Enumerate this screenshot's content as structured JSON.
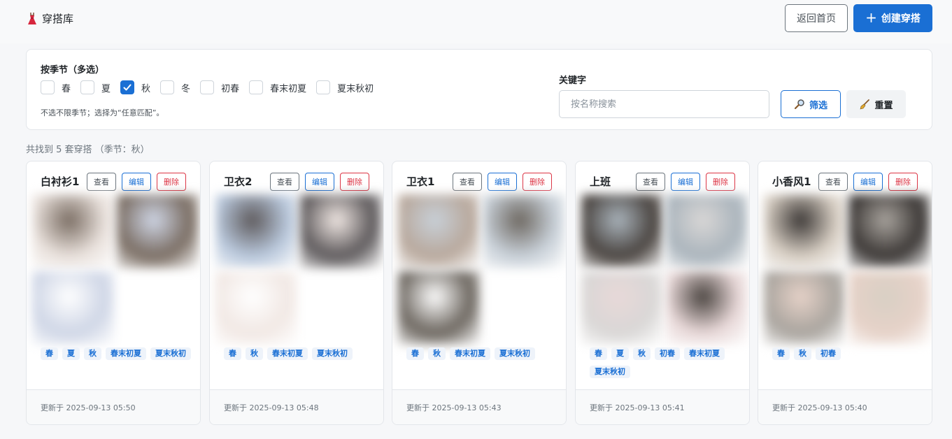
{
  "header": {
    "brand_icon": "dress-icon",
    "title": "穿搭库",
    "home_label": "返回首页",
    "create_label": "创建穿搭"
  },
  "filter": {
    "season_title": "按季节（多选）",
    "seasons": [
      {
        "label": "春",
        "checked": false
      },
      {
        "label": "夏",
        "checked": false
      },
      {
        "label": "秋",
        "checked": true
      },
      {
        "label": "冬",
        "checked": false
      },
      {
        "label": "初春",
        "checked": false
      },
      {
        "label": "春末初夏",
        "checked": false
      },
      {
        "label": "夏末秋初",
        "checked": false
      }
    ],
    "hint": "不选不限季节；选择为“任意匹配”。",
    "keyword_label": "关键字",
    "keyword_placeholder": "按名称搜索",
    "keyword_value": "",
    "filter_label": "筛选",
    "reset_label": "重置"
  },
  "result_text": "共找到 5 套穿搭 （季节：秋）",
  "card_buttons": {
    "view": "查看",
    "edit": "编辑",
    "delete": "删除"
  },
  "cards": [
    {
      "title": "白衬衫1",
      "tags": [
        "春",
        "夏",
        "秋",
        "春末初夏",
        "夏末秋初"
      ],
      "updated": "更新于 2025-09-13 05:50",
      "photos": 3
    },
    {
      "title": "卫衣2",
      "tags": [
        "春",
        "秋",
        "春末初夏",
        "夏末秋初"
      ],
      "updated": "更新于 2025-09-13 05:48",
      "photos": 3
    },
    {
      "title": "卫衣1",
      "tags": [
        "春",
        "秋",
        "春末初夏",
        "夏末秋初"
      ],
      "updated": "更新于 2025-09-13 05:43",
      "photos": 3
    },
    {
      "title": "上班",
      "tags": [
        "春",
        "夏",
        "秋",
        "初春",
        "春末初夏",
        "夏末秋初"
      ],
      "updated": "更新于 2025-09-13 05:41",
      "photos": 4
    },
    {
      "title": "小香风1",
      "tags": [
        "春",
        "秋",
        "初春"
      ],
      "updated": "更新于 2025-09-13 05:40",
      "photos": 4
    }
  ],
  "colors": {
    "primary": "#1a6fd4",
    "danger": "#dc3545",
    "muted": "#6c757d"
  }
}
